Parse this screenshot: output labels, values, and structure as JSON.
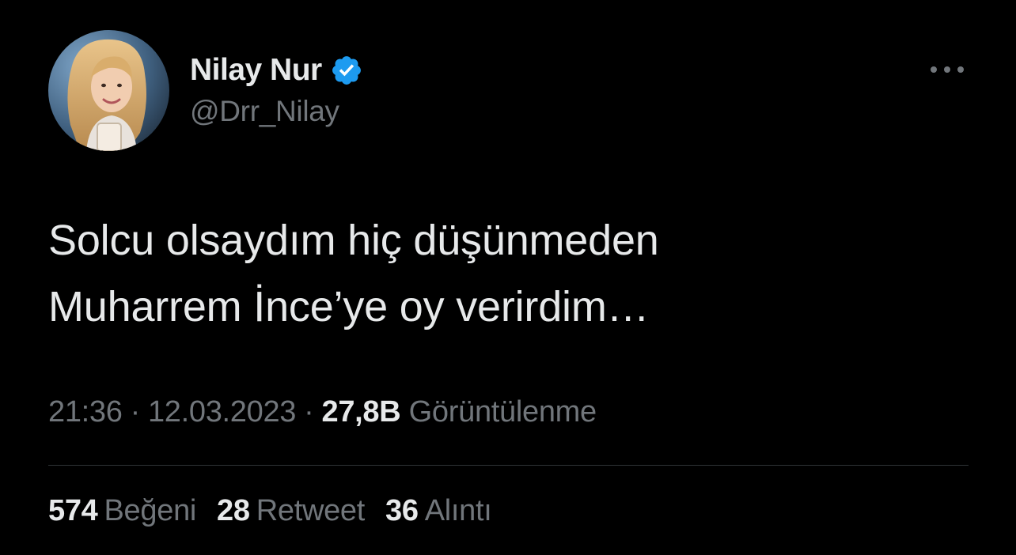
{
  "user": {
    "display_name": "Nilay Nur",
    "handle": "@Drr_Nilay",
    "verified": true,
    "verified_icon": "verified-badge-icon",
    "avatar_icon": "profile-photo"
  },
  "more_icon": "more-horizontal-icon",
  "tweet": {
    "lines": [
      "Solcu olsaydım hiç düşünmeden",
      "Muharrem İnce’ye oy verirdim…"
    ]
  },
  "meta": {
    "time": "21:36",
    "separator": "·",
    "date": "12.03.2023",
    "views_count": "27,8B",
    "views_label": "Görüntülenme"
  },
  "stats": {
    "likes_count": "574",
    "likes_label": "Beğeni",
    "retweets_count": "28",
    "retweets_label": "Retweet",
    "quotes_count": "36",
    "quotes_label": "Alıntı"
  },
  "colors": {
    "background": "#000000",
    "primary_text": "#e7e9ea",
    "secondary_text": "#71767b",
    "verified_blue": "#1d9bf0",
    "divider": "#2f3336"
  }
}
